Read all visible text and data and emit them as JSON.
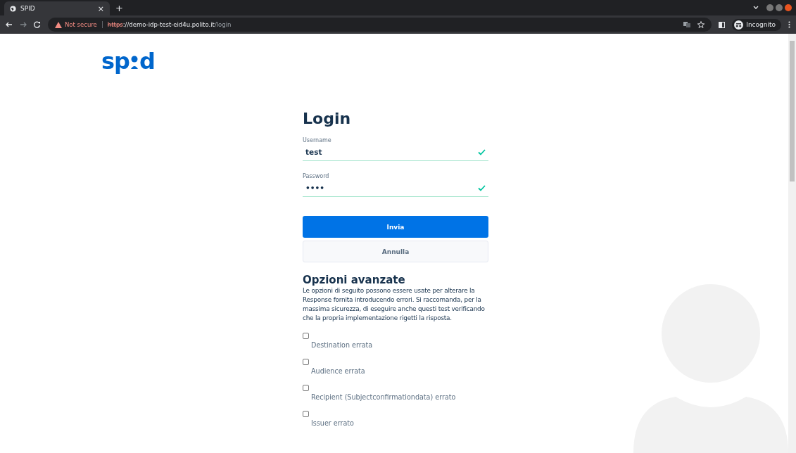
{
  "browser": {
    "tab": {
      "title": "SPID",
      "close": "×"
    },
    "new_tab": "+",
    "security": "Not secure",
    "url_scheme": "https",
    "url_rest": "://demo-idp-test-eid4u.polito.it",
    "url_path": "/login",
    "profile": "Incognito"
  },
  "logo": {
    "before": "sp",
    "after": "d"
  },
  "login": {
    "title": "Login",
    "fields": [
      {
        "label": "Username",
        "value": "test",
        "valid": true
      },
      {
        "label": "Password",
        "value": "••••",
        "valid": true
      }
    ],
    "submit": "Invia",
    "cancel": "Annulla"
  },
  "advanced": {
    "title": "Opzioni avanzate",
    "description": "Le opzioni di seguito possono essere usate per alterare la Response fornita introducendo errori. Si raccomanda, per la massima sicurezza, di eseguire anche questi test verificando che la propria implementazione rigetti la risposta.",
    "options": [
      {
        "label": "Destination errata",
        "checked": false
      },
      {
        "label": "Audience errata",
        "checked": false
      },
      {
        "label": "Recipient (Subjectconfirmationdata) errato",
        "checked": false
      },
      {
        "label": "Issuer errato",
        "checked": false
      }
    ]
  }
}
